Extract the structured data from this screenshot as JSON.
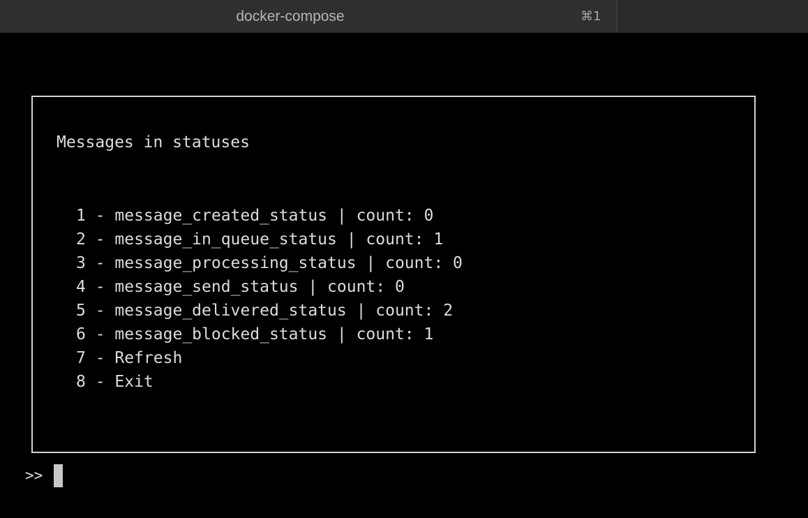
{
  "window": {
    "tab_title": "docker-compose",
    "tab_shortcut": "⌘1"
  },
  "menu": {
    "title": "Messages in statuses",
    "items": [
      {
        "label": "1 - message_created_status | count: 0"
      },
      {
        "label": "2 - message_in_queue_status | count: 1"
      },
      {
        "label": "3 - message_processing_status | count: 0"
      },
      {
        "label": "4 - message_send_status | count: 0"
      },
      {
        "label": "5 - message_delivered_status | count: 2"
      },
      {
        "label": "6 - message_blocked_status | count: 1"
      },
      {
        "label": "7 - Refresh"
      },
      {
        "label": "8 - Exit"
      }
    ]
  },
  "prompt": {
    "symbol": ">>"
  }
}
